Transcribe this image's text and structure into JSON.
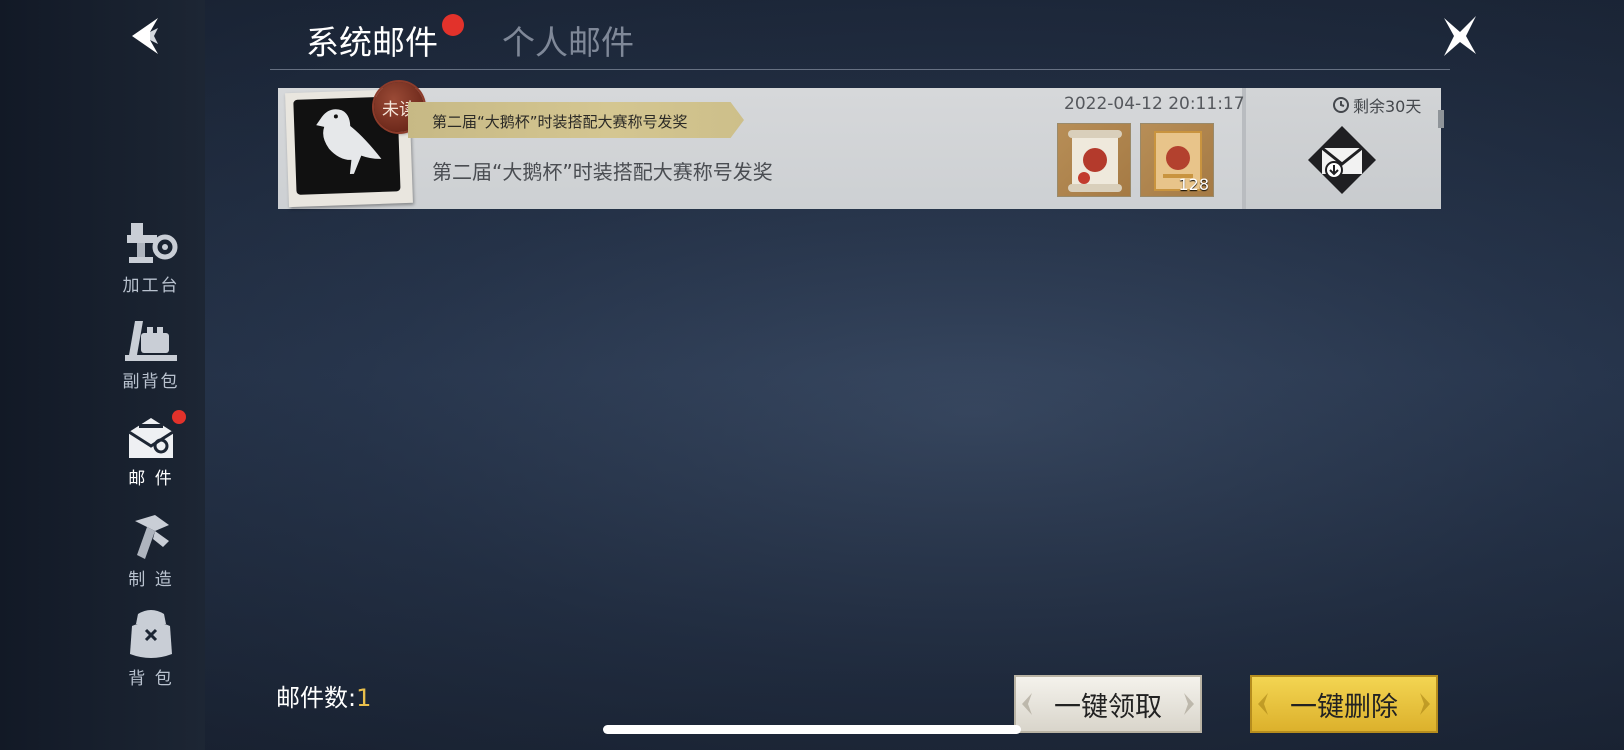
{
  "tabs": [
    {
      "label": "系统邮件",
      "active": true,
      "has_badge": true
    },
    {
      "label": "个人邮件",
      "active": false,
      "has_badge": false
    }
  ],
  "sidebar": {
    "back_icon": "arrow-left-icon",
    "items": [
      {
        "label": "加工台",
        "icon": "workbench-icon",
        "active": false,
        "has_badge": false
      },
      {
        "label": "副背包",
        "icon": "secondary-backpack-icon",
        "active": false,
        "has_badge": false
      },
      {
        "label": "邮 件",
        "icon": "mail-icon",
        "active": true,
        "has_badge": true
      },
      {
        "label": "制 造",
        "icon": "crafting-icon",
        "active": false,
        "has_badge": false
      },
      {
        "label": "背 包",
        "icon": "backpack-icon",
        "active": false,
        "has_badge": false
      }
    ]
  },
  "close_icon": "close-x-icon",
  "mail_list": [
    {
      "sender_avatar": "crow-avatar",
      "unread_badge": "未读",
      "title": "第二届“大鹅杯”时装搭配大赛称号发奖",
      "body": "第二届“大鹅杯”时装搭配大赛称号发奖",
      "time": "2022-04-12 20:11:17",
      "remaining": "剩余30天",
      "attachments": [
        {
          "icon": "scroll-icon",
          "count": ""
        },
        {
          "icon": "card-icon",
          "count": "128"
        }
      ],
      "claim_icon": "claim-mail-icon"
    }
  ],
  "footer": {
    "count_label": "邮件数:",
    "count_value": "1",
    "claim_all_label": "一键领取",
    "delete_all_label": "一键删除"
  },
  "colors": {
    "accent_yellow": "#e9bf4c",
    "badge_red": "#e2322b",
    "unread_seal": "#6f2a1c"
  }
}
